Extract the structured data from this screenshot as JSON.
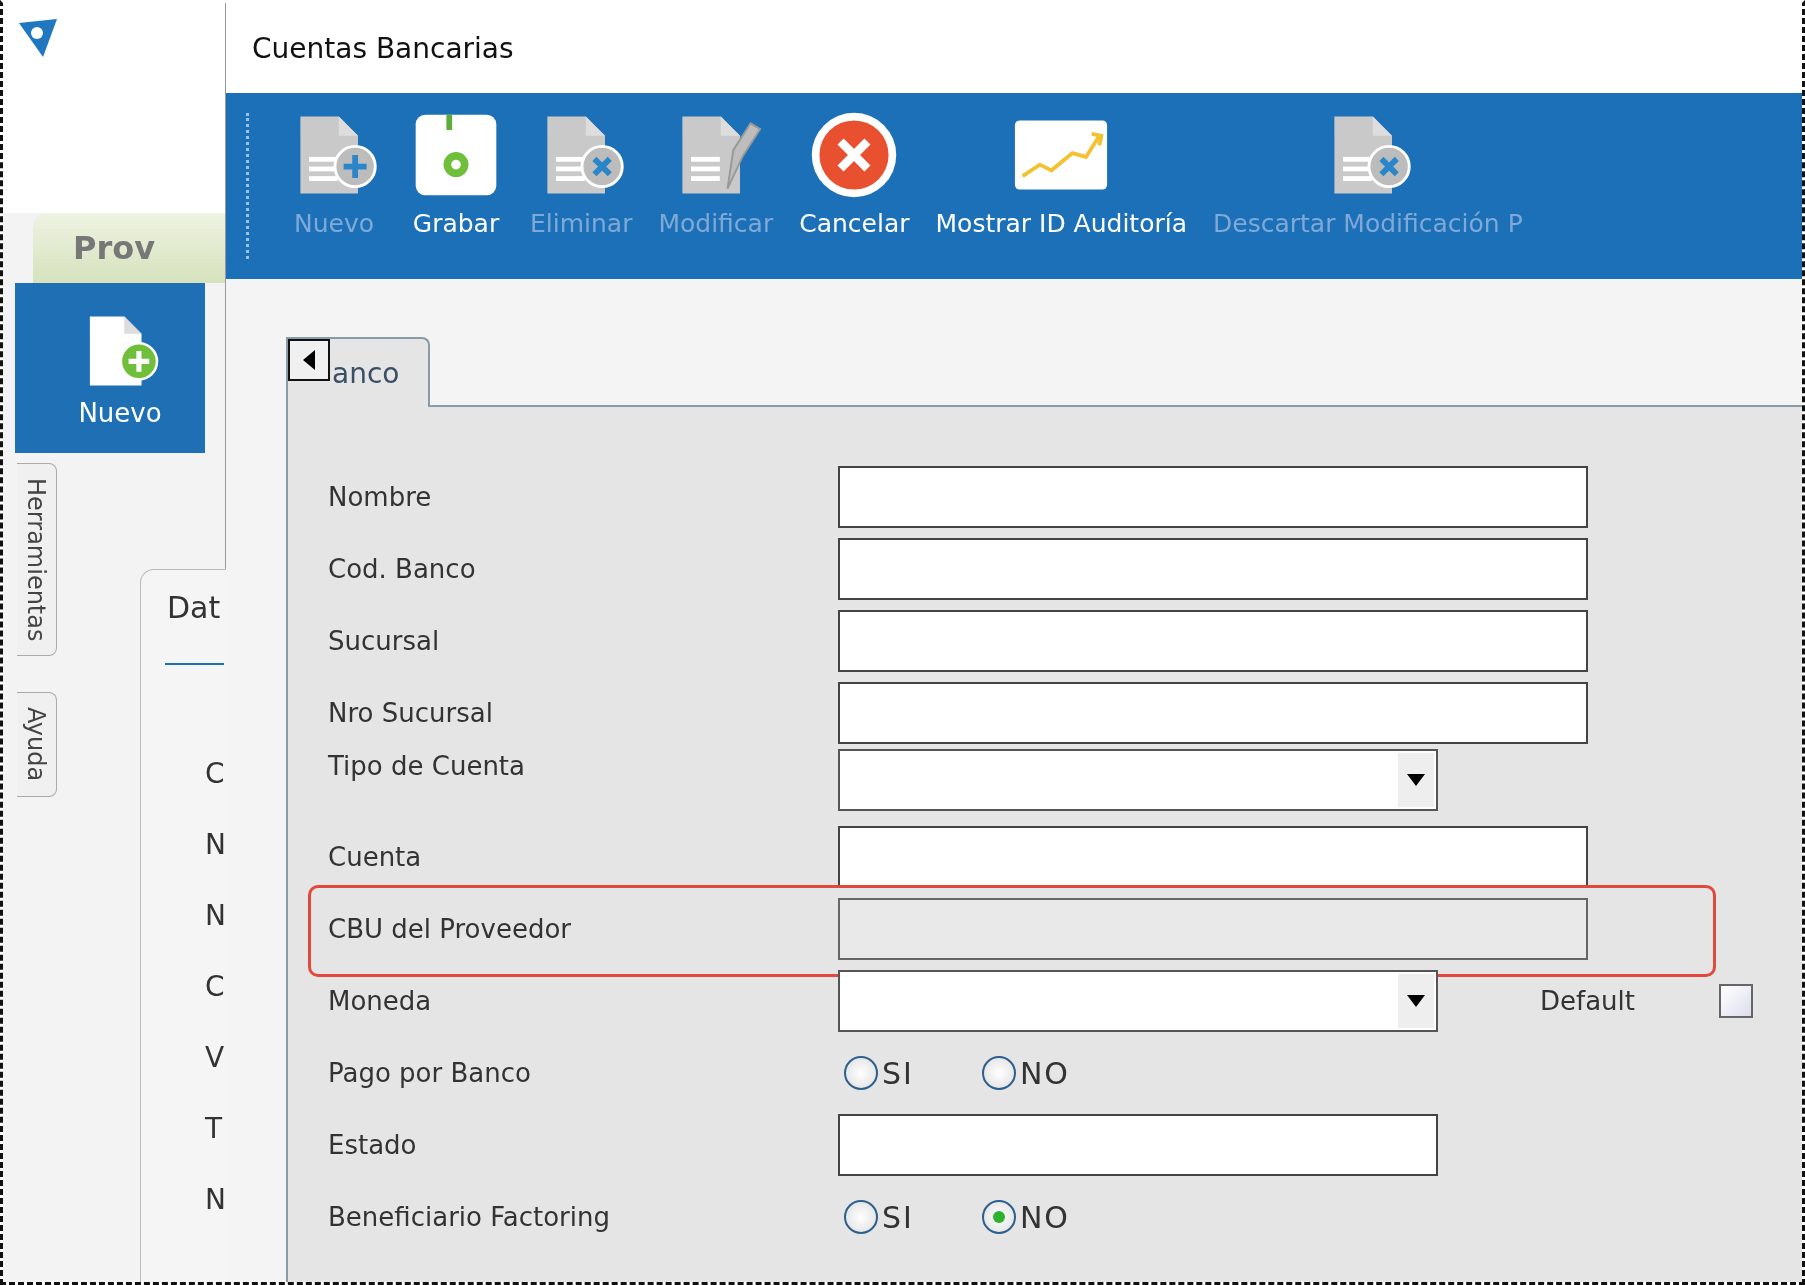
{
  "background_app": {
    "tab": "Prov",
    "toolbar_button": "Nuevo",
    "side_tabs": [
      "Herramientas",
      "Ayuda"
    ],
    "panel_tab": "Dat",
    "row_labels": [
      "C",
      "N",
      "N",
      "C",
      "V",
      "T",
      "N"
    ]
  },
  "dialog": {
    "title": "Cuentas Bancarias",
    "toolbar": [
      {
        "label": "Nuevo",
        "disabled": true
      },
      {
        "label": "Grabar",
        "disabled": false
      },
      {
        "label": "Eliminar",
        "disabled": true
      },
      {
        "label": "Modificar",
        "disabled": true
      },
      {
        "label": "Cancelar",
        "disabled": false
      },
      {
        "label": "Mostrar ID Auditoría",
        "disabled": false
      },
      {
        "label": "Descartar Modificación P",
        "disabled": true
      }
    ],
    "tab": "anco",
    "fields": [
      {
        "label": "Nombre",
        "kind": "text",
        "wide": true,
        "disabled": false,
        "highlighted": false
      },
      {
        "label": "Cod. Banco",
        "kind": "text",
        "wide": true,
        "disabled": false,
        "highlighted": false
      },
      {
        "label": "Sucursal",
        "kind": "text",
        "wide": true,
        "disabled": false,
        "highlighted": false
      },
      {
        "label": "Nro Sucursal",
        "kind": "text",
        "wide": true,
        "disabled": false,
        "highlighted": false
      },
      {
        "label": "Tipo de Cuenta",
        "kind": "combo",
        "wide": false,
        "highlighted": false
      },
      {
        "label": "Cuenta",
        "kind": "text",
        "wide": true,
        "disabled": false,
        "highlighted": false
      },
      {
        "label": "CBU del Proveedor",
        "kind": "text",
        "wide": true,
        "disabled": true,
        "highlighted": true
      },
      {
        "label": "Moneda",
        "kind": "combo",
        "wide": false,
        "highlighted": false,
        "side_checkbox": {
          "label": "Default",
          "checked": false
        }
      },
      {
        "label": "Pago por Banco",
        "kind": "radio",
        "options": [
          {
            "label": "SI",
            "selected": false
          },
          {
            "label": "NO",
            "selected": false
          }
        ]
      },
      {
        "label": "Estado",
        "kind": "text",
        "wide": false,
        "disabled": false,
        "highlighted": false
      },
      {
        "label": "Beneficiario Factoring",
        "kind": "radio",
        "options": [
          {
            "label": "SI",
            "selected": false
          },
          {
            "label": "NO",
            "selected": true
          }
        ]
      }
    ]
  }
}
